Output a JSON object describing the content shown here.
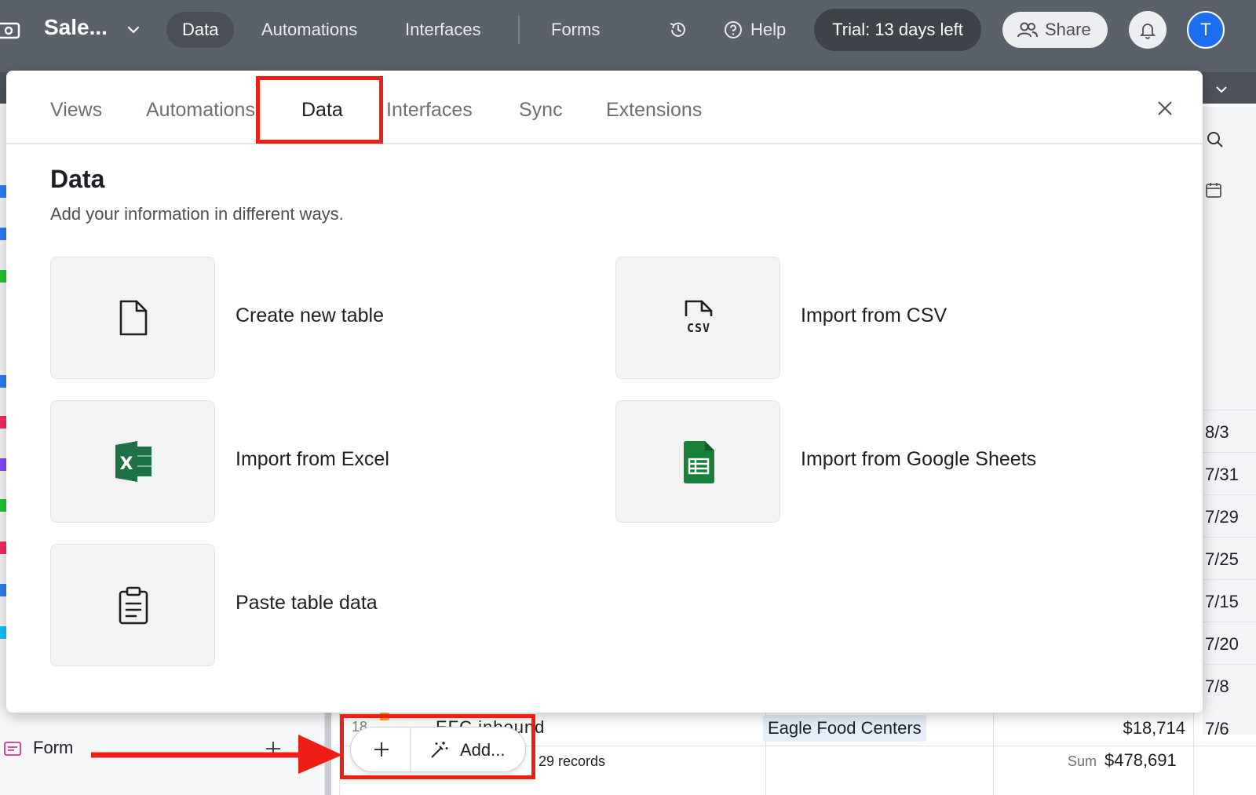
{
  "topbar": {
    "base_name": "Sale...",
    "nav": [
      "Data",
      "Automations",
      "Interfaces",
      "Forms"
    ],
    "active_nav": "Data",
    "help_label": "Help",
    "trial_label": "Trial: 13 days left",
    "share_label": "Share",
    "avatar_initial": "T"
  },
  "modal": {
    "tabs": [
      "Views",
      "Automations",
      "Data",
      "Interfaces",
      "Sync",
      "Extensions"
    ],
    "active_tab": "Data",
    "title": "Data",
    "subtitle": "Add your information in different ways.",
    "options": [
      {
        "label": "Create new table",
        "icon": "file-icon"
      },
      {
        "label": "Import from CSV",
        "icon": "csv-file-icon"
      },
      {
        "label": "Import from Excel",
        "icon": "excel-icon"
      },
      {
        "label": "Import from Google Sheets",
        "icon": "google-sheets-icon"
      },
      {
        "label": "Paste table data",
        "icon": "clipboard-icon"
      }
    ]
  },
  "sidebar": {
    "form_item_label": "Form"
  },
  "grid": {
    "row_number": "18",
    "row_name": "EFC inbound",
    "company": "Eagle Food Centers",
    "amount": "$18,714",
    "records": "29 records",
    "sum_label": "Sum",
    "sum_value": "$478,691",
    "dates": [
      "8/3",
      "7/31",
      "7/29",
      "7/25",
      "7/15",
      "7/20",
      "7/8",
      "7/6"
    ],
    "add_label": "Add..."
  },
  "colors": {
    "topbar": "#5b616a",
    "highlight": "#ef1d13",
    "excel_green": "#1e7145",
    "sheets_green": "#188038",
    "avatar_blue": "#1d6ef0"
  }
}
